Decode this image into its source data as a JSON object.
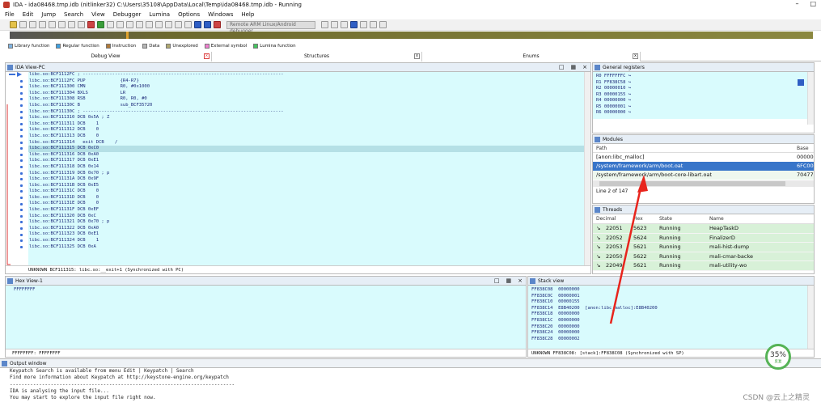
{
  "window": {
    "title": "IDA - ida08468.tmp.idb (nitlinker32) C:\\Users\\35108\\AppData\\Local\\Temp\\ida08468.tmp.idb - Running"
  },
  "menu": [
    "File",
    "Edit",
    "Jump",
    "Search",
    "View",
    "Debugger",
    "Lumina",
    "Options",
    "Windows",
    "Help"
  ],
  "toolbar": {
    "debugger_select": "Remote ARM Linux/Android debugger"
  },
  "legend": [
    {
      "label": "Library function",
      "color": "#7fb3e0"
    },
    {
      "label": "Regular function",
      "color": "#3fa0e0"
    },
    {
      "label": "Instruction",
      "color": "#b07a3a"
    },
    {
      "label": "Data",
      "color": "#b5b5b5"
    },
    {
      "label": "Unexplored",
      "color": "#b0a870"
    },
    {
      "label": "External symbol",
      "color": "#f07fd0"
    },
    {
      "label": "Lumina function",
      "color": "#45c460"
    }
  ],
  "tabs": [
    "Debug View",
    "Structures",
    "Enums"
  ],
  "ida_view": {
    "title": "IDA View-PC",
    "lines": [
      "libc.so:BCF1112FC ; ---------------------------------------------------------------------------",
      "libc.so:BCF1112FC PUP             {R4-R7}",
      "libc.so:BCF111300 CMN             R0, #0x1000",
      "libc.so:BCF111304 BXLS            LR",
      "libc.so:BCF111308 RSB             R0, R0, #0",
      "libc.so:BCF11130C B               sub_BCF35720",
      "libc.so:BCF11130C ; ---------------------------------------------------------------------------",
      "libc.so:BCF111310 DCB 0x5A ; Z",
      "libc.so:BCF111311 DCB    1",
      "libc.so:BCF111312 DCB    0",
      "libc.so:BCF111313 DCB    0",
      "libc.so:BCF111314   exit DCB    /",
      "libc.so:BCF111315 DCB 0xC0",
      "libc.so:BCF111316 DCB 0xA0",
      "libc.so:BCF111317 DCB 0xE1",
      "libc.so:BCF111318 DCB 0x14",
      "libc.so:BCF111319 DCB 0x70 ; p",
      "libc.so:BCF11131A DCB 0x9F",
      "libc.so:BCF11131B DCB 0xE5",
      "libc.so:BCF11131C DCB    0",
      "libc.so:BCF11131D DCB    0",
      "libc.so:BCF11131E DCB    0",
      "libc.so:BCF11131F DCB 0xEF",
      "libc.so:BCF111320 DCB 0xC",
      "libc.so:BCF111321 DCB 0x70 ; p",
      "libc.so:BCF111322 DCB 0xA0",
      "libc.so:BCF111323 DCB 0xE1",
      "libc.so:BCF111324 DCB    1",
      "libc.so:BCF111325 DCB 0xA"
    ],
    "highlight_index": 12,
    "status": "UNKNOWN BCF111315: libc.so:__exit+1 (Synchronized with PC)"
  },
  "registers": {
    "title": "General registers",
    "rows": [
      "R0 FFFFFFFC ↪",
      "R1 FF838C58 ↪",
      "R2 00000010 ↪",
      "R3 00000155 ↪",
      "R4 00000000 ↪",
      "R5 00000001 ↪",
      "R6 00000000 ↪"
    ]
  },
  "modules": {
    "title": "Modules",
    "col_path": "Path",
    "col_base": "Base",
    "rows": [
      {
        "path": "[anon:libc_malloc]",
        "base": "00000"
      },
      {
        "path": "/system/framework/arm/boot.oat",
        "base": "6FC00"
      },
      {
        "path": "/system/framework/arm/boot-core-libart.oat",
        "base": "70477"
      }
    ],
    "selected_index": 1,
    "status": "Line 2 of 147"
  },
  "threads": {
    "title": "Threads",
    "cols": [
      "Decimal",
      "Hex",
      "State",
      "Name"
    ],
    "rows": [
      [
        "22051",
        "5623",
        "Running",
        "HeapTaskD"
      ],
      [
        "22052",
        "5624",
        "Running",
        "FinalizerD"
      ],
      [
        "22053",
        "5621",
        "Running",
        "mali-hist-dump"
      ],
      [
        "22050",
        "5622",
        "Running",
        "mali-cmar-backe"
      ],
      [
        "22049",
        "5621",
        "Running",
        "mali-utility-wo"
      ]
    ]
  },
  "hex_view": {
    "title": "Hex View-1",
    "first_line": "FFFFFFFF",
    "status": "FFFFFFFF: FFFFFFFF"
  },
  "stack_view": {
    "title": "Stack view",
    "lines": [
      "FF838C08  00000000",
      "FF838C0C  00000001",
      "FF838C10  00000155",
      "FF838C14  E8B40200  [anon:libc_malloc]:E8B40200",
      "FF838C18  00000000",
      "FF838C1C  00000000",
      "FF838C20  00000000",
      "FF838C24  00000000",
      "FF838C28  00000002"
    ],
    "status": "UNKNOWN FF838C08: [stack]:FF838C08 (Synchronized with SP)"
  },
  "output": {
    "title": "Output window",
    "lines": [
      "Keypatch Search is available from menu Edit | Keypatch | Search",
      "Find more information about Keypatch at http://keystone-engine.org/keypatch",
      "-----------------------------------------------------------------------------",
      "IDA is analysing the input file...",
      "You may start to explore the input file right now."
    ]
  },
  "cpu": {
    "percent": "35%",
    "sub": "反复"
  },
  "watermark": "CSDN @云上之精灵"
}
